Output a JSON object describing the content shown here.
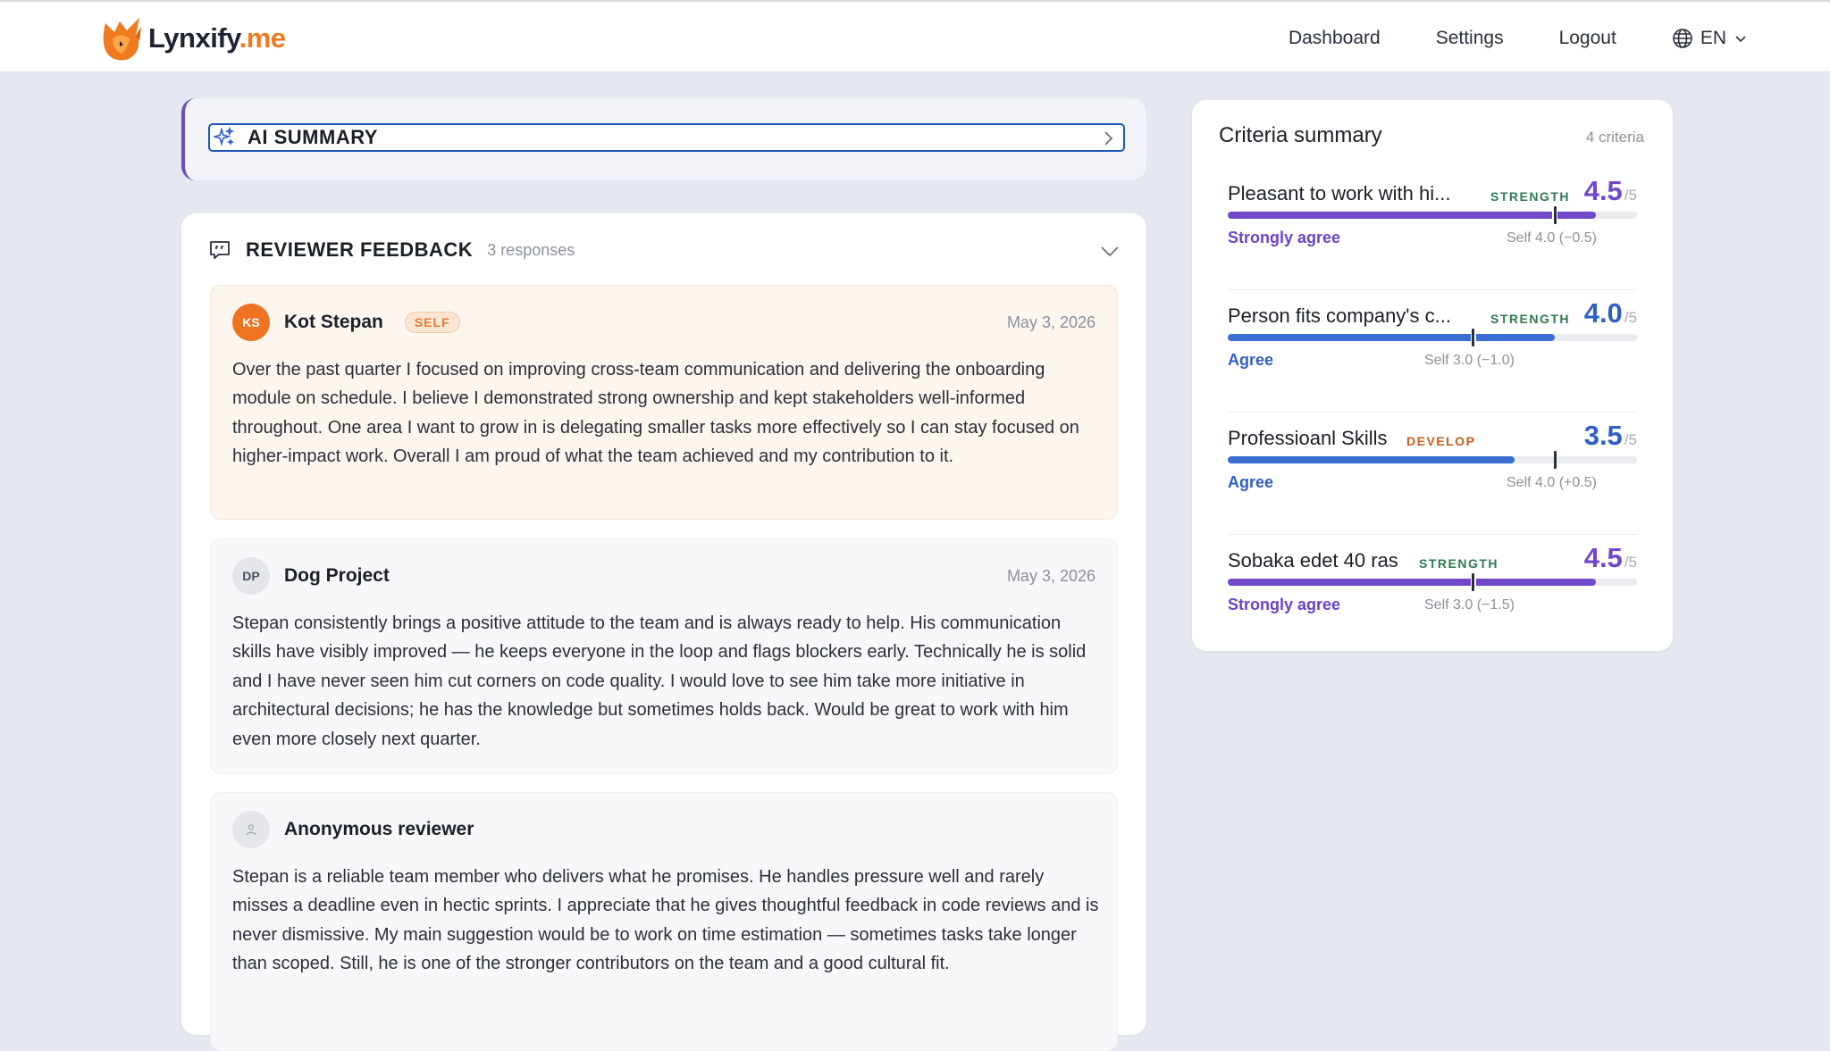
{
  "brand": {
    "name_main": "Lynxify",
    "name_accent": ".me",
    "logo_icon": "lynx-head-logo"
  },
  "nav": {
    "items": [
      "Dashboard",
      "Settings",
      "Logout"
    ],
    "language": "EN",
    "language_icon": "globe-icon"
  },
  "ai_summary": {
    "title": "AI SUMMARY",
    "icon": "sparkle-icon"
  },
  "feedback": {
    "title": "REVIEWER FEEDBACK",
    "count": "3 responses",
    "reviews": [
      {
        "initials": "KS",
        "name": "Kot Stepan",
        "badge": "SELF",
        "date": "May 3, 2026",
        "text": "Over the past quarter I focused on improving cross-team communication and delivering the onboarding module on schedule. I believe I demonstrated strong ownership and kept stakeholders well-informed throughout. One area I want to grow in is delegating smaller tasks more effectively so I can stay focused on higher-impact work. Overall I am proud of what the team achieved and my contribution to it."
      },
      {
        "initials": "DP",
        "name": "Dog Project",
        "date": "May 3, 2026",
        "text": "Stepan consistently brings a positive attitude to the team and is always ready to help. His communication skills have visibly improved — he keeps everyone in the loop and flags blockers early. Technically he is solid and I have never seen him cut corners on code quality. I would love to see him take more initiative in architectural decisions; he has the knowledge but sometimes holds back. Would be great to work with him even more closely next quarter."
      },
      {
        "initials": "",
        "name": "Anonymous reviewer",
        "date": "",
        "text": "Stepan is a reliable team member who delivers what he promises. He handles pressure well and rarely misses a deadline even in hectic sprints. I appreciate that he gives thoughtful feedback in code reviews and is never dismissive. My main suggestion would be to work on time estimation — sometimes tasks take longer than scoped. Still, he is one of the stronger contributors on the team and a good cultural fit."
      }
    ]
  },
  "criteria": {
    "title": "Criteria summary",
    "count": "4 criteria",
    "out_of": "/5",
    "items": [
      {
        "name": "Pleasant to work with hi...",
        "tag": "STRENGTH",
        "score": "4.5",
        "score_value": 4.5,
        "self_value": 4.0,
        "agree": "Strongly agree",
        "self_text": "Self 4.0 (−0.5)",
        "color": "#7048c9"
      },
      {
        "name": "Person fits company's c...",
        "tag": "STRENGTH",
        "score": "4.0",
        "score_value": 4.0,
        "self_value": 3.0,
        "agree": "Agree",
        "self_text": "Self 3.0 (−1.0)",
        "color": "#3b6ed3"
      },
      {
        "name": "Professioanl Skills",
        "tag": "DEVELOP",
        "score": "3.5",
        "score_value": 3.5,
        "self_value": 4.0,
        "agree": "Agree",
        "self_text": "Self 4.0 (+0.5)",
        "color": "#3b6ed3"
      },
      {
        "name": "Sobaka edet 40 ras",
        "tag": "STRENGTH",
        "score": "4.5",
        "score_value": 4.5,
        "self_value": 3.0,
        "agree": "Strongly agree",
        "self_text": "Self 3.0 (−1.5)",
        "color": "#7048c9"
      }
    ]
  }
}
